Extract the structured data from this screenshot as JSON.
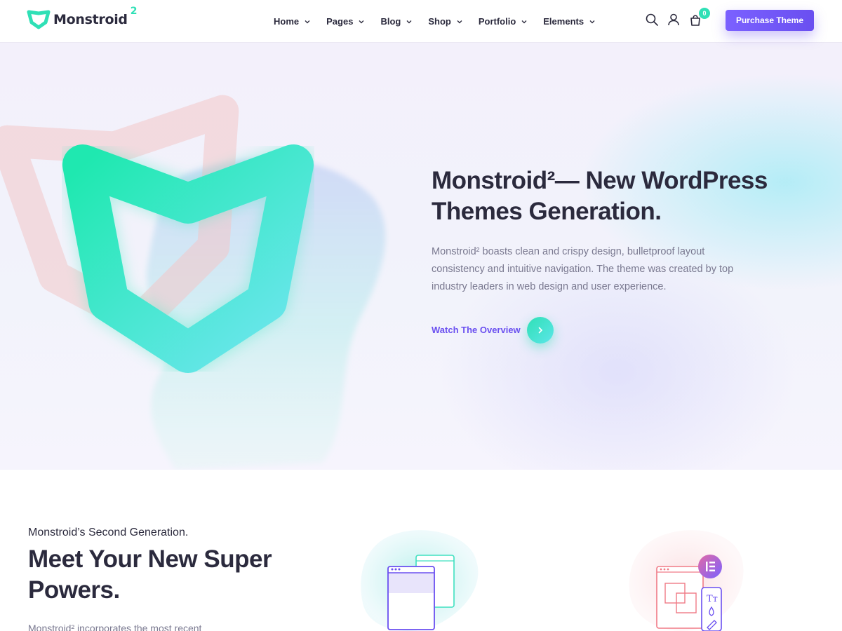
{
  "header": {
    "logo_text": "Monstroid",
    "logo_sup": "2",
    "nav": [
      {
        "label": "Home"
      },
      {
        "label": "Pages"
      },
      {
        "label": "Blog"
      },
      {
        "label": "Shop"
      },
      {
        "label": "Portfolio"
      },
      {
        "label": "Elements"
      }
    ],
    "icons": [
      "search-icon",
      "user-icon",
      "cart-icon"
    ],
    "cart_count": "0",
    "purchase_label": "Purchase Theme"
  },
  "hero": {
    "title_line1": "Monstroid²— New WordPress",
    "title_line2": "Themes Generation.",
    "description": "Monstroid² boasts clean and crispy design, bulletproof layout consistency and intuitive navigation. The theme was created by top industry leaders in web design and user experience.",
    "watch_label": "Watch The Overview"
  },
  "section2": {
    "subtitle": "Monstroid’s Second Generation.",
    "title": "Meet Your New Super Powers.",
    "text": "Monstroid² incorporates the most recent"
  },
  "colors": {
    "accent_purple": "#6a4ff0",
    "accent_teal": "#2fe0b6",
    "text_dark": "#2b2a3d",
    "text_muted": "#7a7990"
  }
}
